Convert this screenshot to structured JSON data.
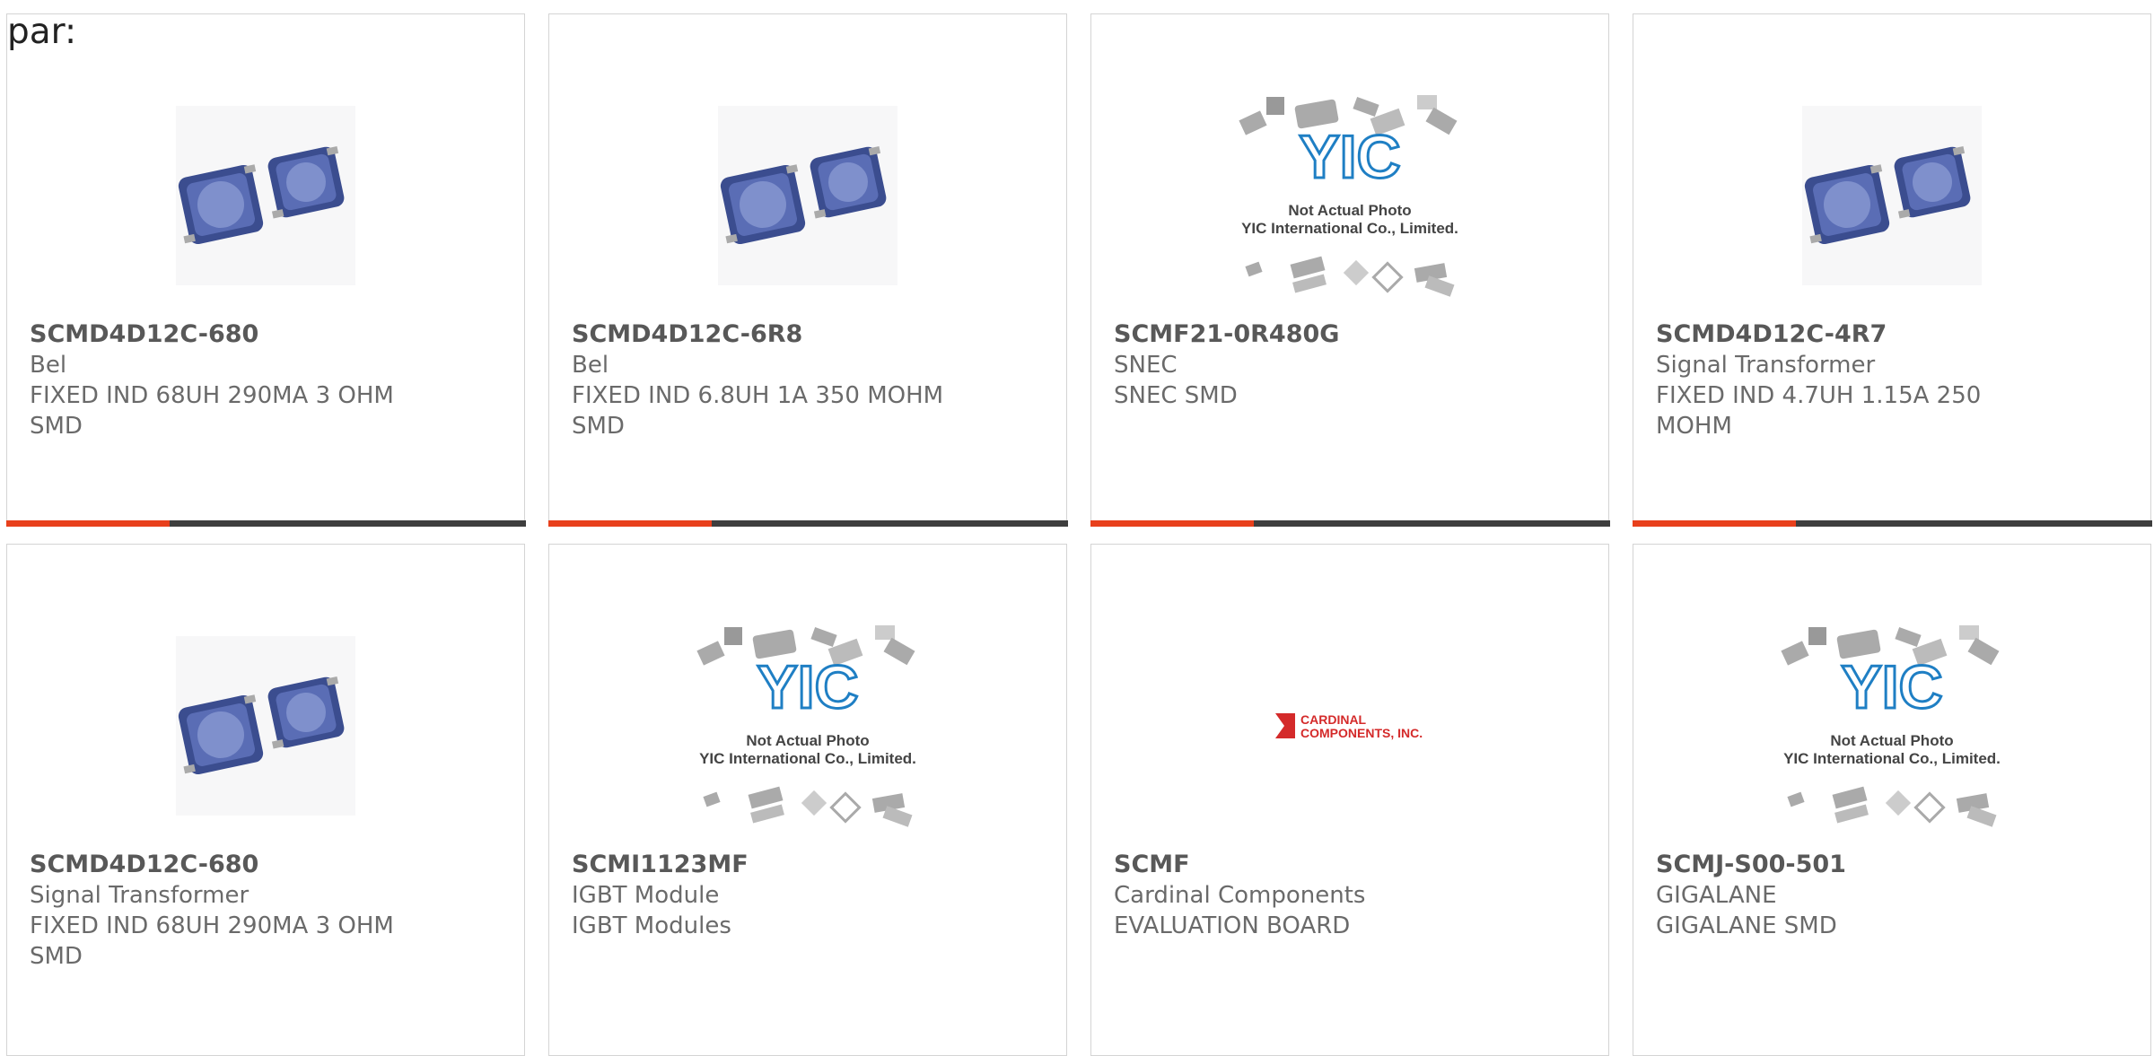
{
  "header": {
    "label": "par:"
  },
  "products": [
    {
      "part": "SCMD4D12C-680",
      "manufacturer": "Bel",
      "description": "FIXED IND 68UH 290MA 3 OHM SMD",
      "image": "inductor-photo"
    },
    {
      "part": "SCMD4D12C-6R8",
      "manufacturer": "Bel",
      "description": "FIXED IND 6.8UH 1A 350 MOHM SMD",
      "image": "inductor-photo"
    },
    {
      "part": "SCMF21-0R480G",
      "manufacturer": "SNEC",
      "description": "SNEC SMD",
      "image": "yic-placeholder"
    },
    {
      "part": "SCMD4D12C-4R7",
      "manufacturer": "Signal Transformer",
      "description": "FIXED IND 4.7UH 1.15A 250 MOHM",
      "image": "inductor-photo"
    },
    {
      "part": "SCMD4D12C-680",
      "manufacturer": "Signal Transformer",
      "description": "FIXED IND 68UH 290MA 3 OHM SMD",
      "image": "inductor-photo"
    },
    {
      "part": "SCMI1123MF",
      "manufacturer": "IGBT Module",
      "description": "IGBT Modules",
      "image": "yic-placeholder"
    },
    {
      "part": "SCMF",
      "manufacturer": "Cardinal Components",
      "description": "EVALUATION BOARD",
      "image": "cardinal-logo"
    },
    {
      "part": "SCMJ-S00-501",
      "manufacturer": "GIGALANE",
      "description": "GIGALANE SMD",
      "image": "yic-placeholder"
    }
  ],
  "placeholder": {
    "line1": "Not Actual Photo",
    "line2": "YIC International Co., Limited.",
    "brand": "YIC"
  },
  "cardinal": {
    "line1": "CARDINAL",
    "line2": "COMPONENTS, INC."
  },
  "colors": {
    "accent": "#e8401c",
    "bar": "#3e3e3e",
    "inductor": "#4e62a8",
    "yic_blue": "#1f7fc4",
    "cardinal_red": "#d42a2a"
  }
}
